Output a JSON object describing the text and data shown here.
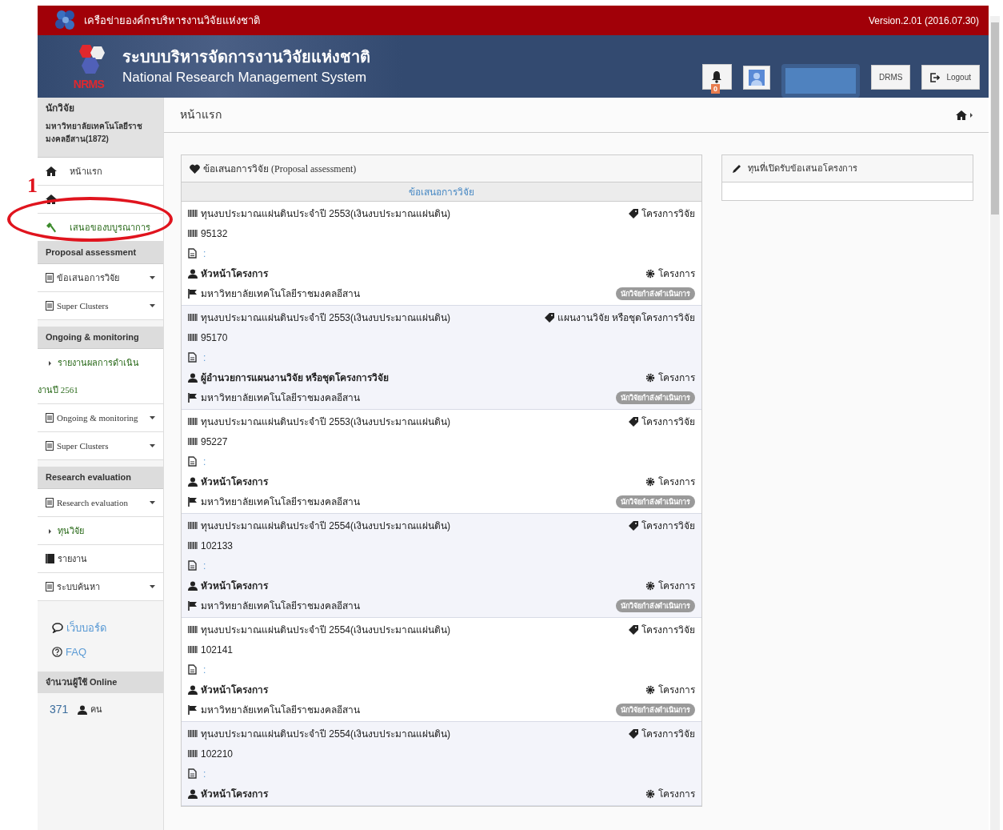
{
  "top_bar": {
    "network_name": "เครือข่ายองค์กรบริหารงานวิจัยแห่งชาติ",
    "version": "Version.2.01 (2016.07.30)"
  },
  "header": {
    "title_th": "ระบบบริหารจัดการงานวิจัยแห่งชาติ",
    "title_en": "National Research Management System",
    "logo_text": "NRMS",
    "notification_count": "0",
    "buttons": [
      "DRMS",
      "Logout"
    ]
  },
  "sidebar": {
    "role": "นักวิจัย",
    "org": "มหาวิทยาลัยเทคโนโลยีราชมงคลอีสาน(1872)",
    "items": [
      {
        "kind": "home",
        "label": "หน้าแรก"
      },
      {
        "kind": "home"
      },
      {
        "kind": "hammer",
        "label": "เสนอของบบูรณาการ"
      },
      {
        "kind": "section",
        "label": "Proposal assessment"
      },
      {
        "kind": "menu",
        "label": "ข้อเสนอการวิจัย"
      },
      {
        "kind": "menu",
        "label": "Super Clusters"
      },
      {
        "kind": "section",
        "label": "Ongoing & monitoring"
      },
      {
        "kind": "sub",
        "label": "รายงานผลการดำเนินงานปี 2561"
      },
      {
        "kind": "menu",
        "label": "Ongoing & monitoring"
      },
      {
        "kind": "menu",
        "label": "Super Clusters"
      },
      {
        "kind": "section",
        "label": "Research evaluation"
      },
      {
        "kind": "menu",
        "label": "Research evaluation"
      },
      {
        "kind": "sub",
        "label": "ทุนวิจัย"
      },
      {
        "kind": "book",
        "label": "รายงาน"
      },
      {
        "kind": "menu",
        "label": "ระบบค้นหา"
      }
    ],
    "links": [
      {
        "kind": "chat",
        "label": "เว็บบอร์ด"
      },
      {
        "kind": "help",
        "label": "FAQ"
      }
    ],
    "online": {
      "title": "จำนวนผู้ใช้ Online",
      "count": "371",
      "unit": "คน"
    }
  },
  "page_title": "หน้าแรก",
  "proposals": {
    "title": "ข้อเสนอการวิจัย (Proposal assessment)",
    "subtitle": "ข้อเสนอการวิจัย",
    "rows": [
      {
        "fund": "ทุนงบประมาณแผ่นดินประจำปี 2553(เงินงบประมาณแผ่นดิน)",
        "type": "โครงการวิจัย",
        "code": "95132",
        "doc": ":",
        "role": "หัวหน้าโครงการ",
        "category": "โครงการ",
        "org": "มหาวิทยาลัยเทคโนโลยีราชมงคลอีสาน",
        "status": "นักวิจัยกำลังดำเนินการ"
      },
      {
        "fund": "ทุนงบประมาณแผ่นดินประจำปี 2553(เงินงบประมาณแผ่นดิน)",
        "type": "แผนงานวิจัย หรือชุดโครงการวิจัย",
        "code": "95170",
        "doc": ":",
        "role": "ผู้อำนวยการแผนงานวิจัย หรือชุดโครงการวิจัย",
        "category": "โครงการ",
        "org": "มหาวิทยาลัยเทคโนโลยีราชมงคลอีสาน",
        "status": "นักวิจัยกำลังดำเนินการ"
      },
      {
        "fund": "ทุนงบประมาณแผ่นดินประจำปี 2553(เงินงบประมาณแผ่นดิน)",
        "type": "โครงการวิจัย",
        "code": "95227",
        "doc": ":",
        "role": "หัวหน้าโครงการ",
        "category": "โครงการ",
        "org": "มหาวิทยาลัยเทคโนโลยีราชมงคลอีสาน",
        "status": "นักวิจัยกำลังดำเนินการ"
      },
      {
        "fund": "ทุนงบประมาณแผ่นดินประจำปี 2554(เงินงบประมาณแผ่นดิน)",
        "type": "โครงการวิจัย",
        "code": "102133",
        "doc": ":",
        "role": "หัวหน้าโครงการ",
        "category": "โครงการ",
        "org": "มหาวิทยาลัยเทคโนโลยีราชมงคลอีสาน",
        "status": "นักวิจัยกำลังดำเนินการ"
      },
      {
        "fund": "ทุนงบประมาณแผ่นดินประจำปี 2554(เงินงบประมาณแผ่นดิน)",
        "type": "โครงการวิจัย",
        "code": "102141",
        "doc": ":",
        "role": "หัวหน้าโครงการ",
        "category": "โครงการ",
        "org": "มหาวิทยาลัยเทคโนโลยีราชมงคลอีสาน",
        "status": "นักวิจัยกำลังดำเนินการ"
      },
      {
        "fund": "ทุนงบประมาณแผ่นดินประจำปี 2554(เงินงบประมาณแผ่นดิน)",
        "type": "โครงการวิจัย",
        "code": "102210",
        "doc": ":",
        "role": "หัวหน้าโครงการ",
        "category": "โครงการ"
      }
    ]
  },
  "open_funds": {
    "title": "ทุนที่เปิดรับข้อเสนอโครงการ"
  },
  "annotation": {
    "label": "1"
  }
}
